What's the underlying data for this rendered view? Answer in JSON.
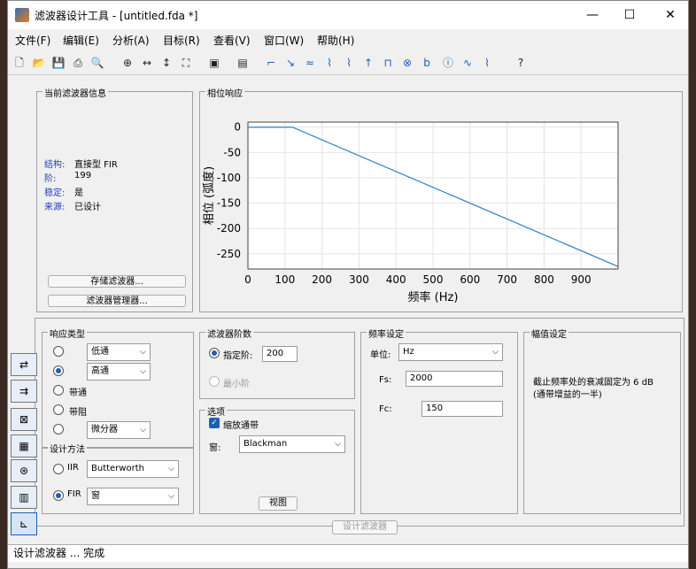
{
  "window": {
    "title": "滤波器设计工具 - [untitled.fda *]",
    "min": "—",
    "max": "☐",
    "close": "✕"
  },
  "menu": [
    "文件(F)",
    "编辑(E)",
    "分析(A)",
    "目标(R)",
    "查看(V)",
    "窗口(W)",
    "帮助(H)"
  ],
  "info_panel": {
    "title": "当前滤波器信息",
    "rows": [
      {
        "k": "结构:",
        "v": "直接型 FIR"
      },
      {
        "k": "阶:",
        "v": "199"
      },
      {
        "k": "稳定:",
        "v": "是"
      },
      {
        "k": "来源:",
        "v": "已设计"
      }
    ],
    "store_btn": "存储滤波器...",
    "manager_btn": "滤波器管理器..."
  },
  "plot_panel": {
    "title": "相位响应"
  },
  "chart_data": {
    "type": "line",
    "title": "",
    "xlabel": "频率 (Hz)",
    "ylabel": "相位 (弧度)",
    "xlim": [
      0,
      1000
    ],
    "ylim": [
      -280,
      10
    ],
    "xticks": [
      0,
      100,
      200,
      300,
      400,
      500,
      600,
      700,
      800,
      900
    ],
    "yticks": [
      0,
      -50,
      -100,
      -150,
      -200,
      -250
    ],
    "grid": true,
    "series": [
      {
        "color": "#2f7fc1",
        "x": [
          0,
          120,
          1000
        ],
        "y": [
          0,
          0,
          -275
        ]
      }
    ]
  },
  "response_type": {
    "title": "响应类型",
    "options": [
      "低通",
      "高通",
      "带通",
      "带阻",
      "微分器"
    ],
    "selected": 1,
    "lowpass_select": "低通",
    "highpass_select": "高通",
    "diff_select": "微分器"
  },
  "design_method": {
    "title": "设计方法",
    "iir_label": "IIR",
    "iir_value": "Butterworth",
    "fir_label": "FIR",
    "fir_value": "窗"
  },
  "order": {
    "title": "滤波器阶数",
    "specify": "指定阶:",
    "value": "200",
    "minimum": "最小阶"
  },
  "options": {
    "title": "选项",
    "scale": "缩放通带",
    "window_label": "窗:",
    "window_value": "Blackman",
    "view_btn": "视图"
  },
  "freq": {
    "title": "频率设定",
    "unit_label": "单位:",
    "unit_value": "Hz",
    "fs_label": "Fs:",
    "fs_value": "2000",
    "fc_label": "Fc:",
    "fc_value": "150"
  },
  "mag": {
    "title": "幅值设定",
    "text1": "截止频率处的衰减固定为 6 dB",
    "text2": "(通带增益的一半)"
  },
  "design_btn": "设计滤波器",
  "status": "设计滤波器 ... 完成"
}
